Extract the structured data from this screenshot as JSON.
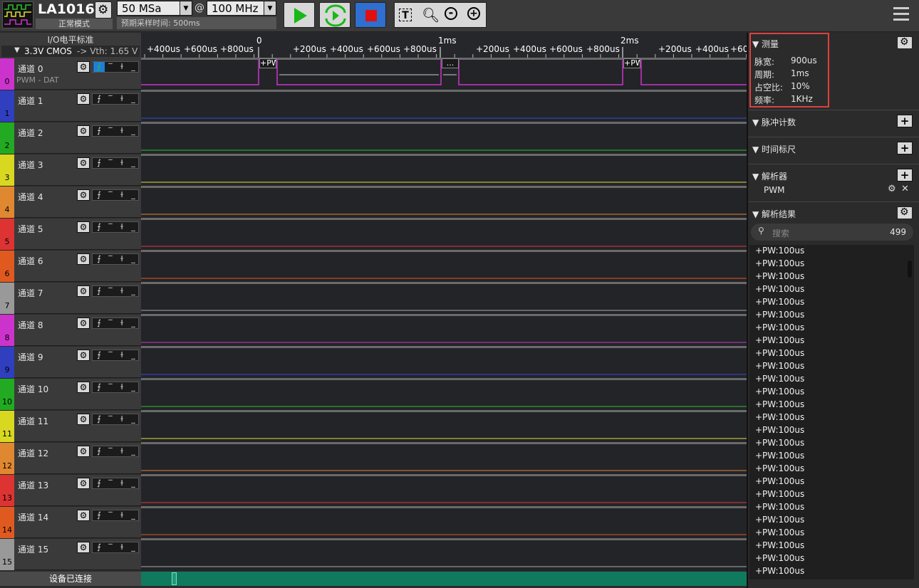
{
  "toolbar": {
    "device_name": "LA1016",
    "mode": "正常模式",
    "sample_depth": "50 MSa",
    "at": "@",
    "sample_rate": "100 MHz",
    "estimated_time": "预期采样时间: 500ms"
  },
  "io_panel": {
    "title": "I/O电平标准",
    "standard": "3.3V CMOS",
    "threshold": "-> Vth: 1.65 V"
  },
  "time_axis": {
    "minor_ticks": [
      "+400us",
      "+600us",
      "+800us",
      "+200us",
      "+400us",
      "+600us",
      "+800us",
      "+200us",
      "+400us",
      "+600us",
      "+800us",
      "+200us",
      "+400us",
      "+60"
    ],
    "major_ticks": [
      "0",
      "1ms",
      "2ms"
    ]
  },
  "channels": [
    {
      "num": "0",
      "name": "通道 0",
      "sub": "PWM - DAT",
      "color": "#cc33cc",
      "trace": "#cc33cc"
    },
    {
      "num": "1",
      "name": "通道 1",
      "sub": "",
      "color": "#2f3fbf",
      "trace": "#3a49d8"
    },
    {
      "num": "2",
      "name": "通道 2",
      "sub": "",
      "color": "#22aa22",
      "trace": "#2ec02e"
    },
    {
      "num": "3",
      "name": "通道 3",
      "sub": "",
      "color": "#d8d820",
      "trace": "#e0e030"
    },
    {
      "num": "4",
      "name": "通道 4",
      "sub": "",
      "color": "#e08830",
      "trace": "#e08830"
    },
    {
      "num": "5",
      "name": "通道 5",
      "sub": "",
      "color": "#dd3333",
      "trace": "#e03838"
    },
    {
      "num": "6",
      "name": "通道 6",
      "sub": "",
      "color": "#e05a20",
      "trace": "#e05a20"
    },
    {
      "num": "7",
      "name": "通道 7",
      "sub": "",
      "color": "#999999",
      "trace": "#aaaaaa"
    },
    {
      "num": "8",
      "name": "通道 8",
      "sub": "",
      "color": "#cc33cc",
      "trace": "#cc33cc"
    },
    {
      "num": "9",
      "name": "通道 9",
      "sub": "",
      "color": "#2f3fbf",
      "trace": "#3a49d8"
    },
    {
      "num": "10",
      "name": "通道 10",
      "sub": "",
      "color": "#22aa22",
      "trace": "#2ec02e"
    },
    {
      "num": "11",
      "name": "通道 11",
      "sub": "",
      "color": "#d8d820",
      "trace": "#e0e030"
    },
    {
      "num": "12",
      "name": "通道 12",
      "sub": "",
      "color": "#e08830",
      "trace": "#e08830"
    },
    {
      "num": "13",
      "name": "通道 13",
      "sub": "",
      "color": "#dd3333",
      "trace": "#e03838"
    },
    {
      "num": "14",
      "name": "通道 14",
      "sub": "",
      "color": "#e05a20",
      "trace": "#e05a20"
    },
    {
      "num": "15",
      "name": "通道 15",
      "sub": "",
      "color": "#999999",
      "trace": "#aaaaaa"
    }
  ],
  "decode_labels": [
    "+PW",
    "...",
    "+PW"
  ],
  "status": "设备已连接",
  "right_panel": {
    "measure_title": "测量",
    "measure": [
      {
        "label": "脉宽:",
        "value": "900us"
      },
      {
        "label": "周期:",
        "value": "1ms"
      },
      {
        "label": "占空比:",
        "value": "10%"
      },
      {
        "label": "频率:",
        "value": "1KHz"
      }
    ],
    "pulse_count": "脉冲计数",
    "time_ruler": "时间标尺",
    "decoders": "解析器",
    "decoder_item": "PWM",
    "results_title": "解析结果",
    "search_placeholder": "搜索",
    "result_count": "499",
    "results": [
      "+PW:100us",
      "+PW:100us",
      "+PW:100us",
      "+PW:100us",
      "+PW:100us",
      "+PW:100us",
      "+PW:100us",
      "+PW:100us",
      "+PW:100us",
      "+PW:100us",
      "+PW:100us",
      "+PW:100us",
      "+PW:100us",
      "+PW:100us",
      "+PW:100us",
      "+PW:100us",
      "+PW:100us",
      "+PW:100us",
      "+PW:100us",
      "+PW:100us",
      "+PW:100us",
      "+PW:100us",
      "+PW:100us",
      "+PW:100us",
      "+PW:100us",
      "+PW:100us"
    ]
  }
}
